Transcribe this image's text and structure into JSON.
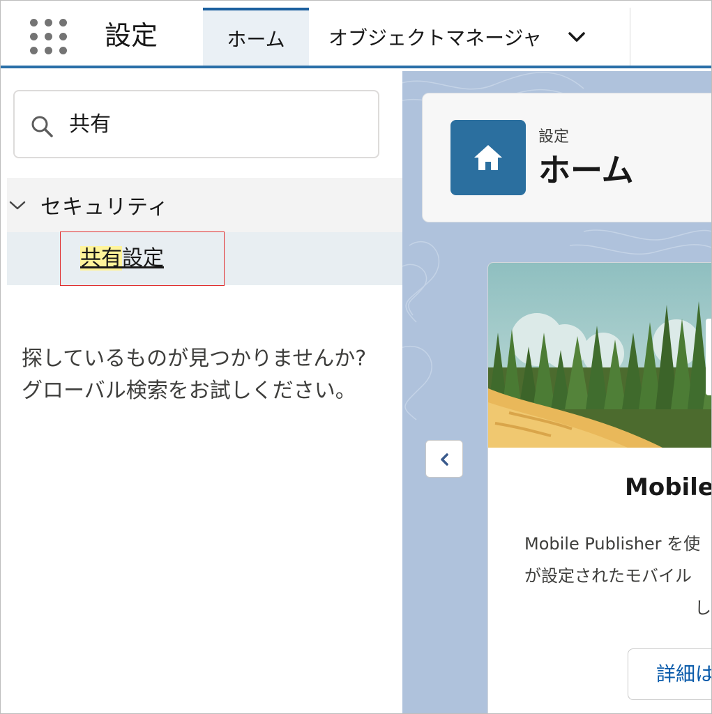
{
  "topbar": {
    "app_launcher_icon": "app-launcher-grid-icon",
    "app_name": "設定",
    "tabs": [
      {
        "label": "ホーム",
        "active": true
      },
      {
        "label": "オブジェクトマネージャ",
        "active": false,
        "dropdown_icon": "chevron-down-icon"
      }
    ],
    "accent_color": "#2a6fa8"
  },
  "sidebar": {
    "search": {
      "icon": "search-icon",
      "value": "共有"
    },
    "section": {
      "label": "セキュリティ",
      "expanded": true,
      "icon": "chevron-down-icon"
    },
    "result": {
      "highlight": "共有",
      "rest": "設定"
    },
    "not_found": {
      "line1": "探しているものが見つかりませんか?",
      "line2": "グローバル検索をお試しください。"
    }
  },
  "main": {
    "header": {
      "icon": "home-icon",
      "subtitle": "設定",
      "title": "ホーム",
      "tile_color": "#2b6f9f"
    },
    "collapse_icon": "chevron-left-icon",
    "feature_card": {
      "title": "Mobile",
      "desc_line1": "Mobile Publisher を使",
      "desc_line2": "が設定されたモバイル",
      "desc_line3": "し",
      "button_label": "詳細は"
    }
  }
}
